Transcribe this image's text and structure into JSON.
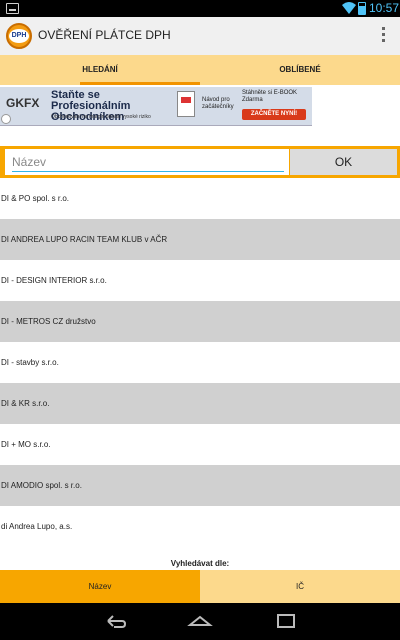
{
  "statusbar": {
    "time": "10:57",
    "wifi_icon": "wifi-icon",
    "battery_icon": "battery-icon"
  },
  "app": {
    "title": "OVĚŘENÍ PLÁTCE DPH",
    "logo_text": "DPH"
  },
  "tabs": [
    {
      "label": "HLEDÁNÍ",
      "selected": true
    },
    {
      "label": "OBLÍBENÉ",
      "selected": false
    }
  ],
  "ad": {
    "logo": "GKFX",
    "headline": "Staňte se Profesionálním Obchodníkem",
    "subtext": "Obchodování na margin obnáší vysoké riziko",
    "guide": "Návod pro začátečníky",
    "download": "Stáhněte si E-BOOK Zdarma",
    "cta": "ZAČNĚTE NYNÍ!"
  },
  "search": {
    "placeholder": "Název",
    "value": "",
    "button_label": "OK"
  },
  "results": [
    "DI  & PO  spol. s r.o.",
    "DI  ANDREA LUPO RACIN TEAM KLUB v AČR",
    "DI - DESIGN INTERIOR s.r.o.",
    "DI - METROS CZ družstvo",
    "DI - stavby s.r.o.",
    "DI & KR s.r.o.",
    "DI + MO s.r.o.",
    "DI AMODIO spol. s r.o.",
    "di Andrea Lupo, a.s."
  ],
  "footer": {
    "label": "Vyhledávat dle:",
    "options": [
      {
        "label": "Název",
        "selected": true
      },
      {
        "label": "IČ",
        "selected": false
      }
    ]
  },
  "colors": {
    "accent": "#f7a600",
    "tab_bg": "#fcd98c",
    "indicator": "#f29400",
    "input_line": "#33b5e5"
  }
}
